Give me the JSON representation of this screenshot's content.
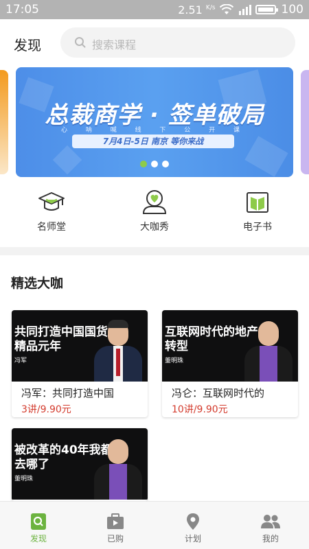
{
  "statusbar": {
    "time": "17:05",
    "speed": "2.51",
    "speed_unit": "K/s",
    "battery": "100"
  },
  "header": {
    "title": "发现",
    "search_placeholder": "搜索课程"
  },
  "banner": {
    "headline": "总裁商学 · 签单破局",
    "subline": "心 呐 喊 线 下 公 开 课",
    "date_pill": "7月4日-5日  南京  等你来战",
    "dots": 3,
    "active_dot": 0
  },
  "categories": [
    {
      "label": "名师堂",
      "icon": "graduation-cap-icon"
    },
    {
      "label": "大咖秀",
      "icon": "heart-person-icon"
    },
    {
      "label": "电子书",
      "icon": "open-book-icon"
    }
  ],
  "section": {
    "title": "精选大咖"
  },
  "courses": [
    {
      "thumb_text": "共同打造中国国货精品元年",
      "speaker": "冯军",
      "title": "冯军：共同打造中国",
      "price": "3讲/9.90元"
    },
    {
      "thumb_text": "互联网时代的地产转型",
      "speaker": "董明珠",
      "title": "冯仑：互联网时代的",
      "price": "10讲/9.90元"
    },
    {
      "thumb_text": "被改革的40年我都去哪了",
      "speaker": "董明珠"
    }
  ],
  "tabs": [
    {
      "label": "发现",
      "icon": "discover-icon",
      "active": true
    },
    {
      "label": "已购",
      "icon": "purchased-icon"
    },
    {
      "label": "计划",
      "icon": "location-pin-icon"
    },
    {
      "label": "我的",
      "icon": "people-icon"
    }
  ],
  "colors": {
    "accent": "#6cb33f",
    "price": "#d33a2c",
    "banner": "#4d8ee8"
  }
}
